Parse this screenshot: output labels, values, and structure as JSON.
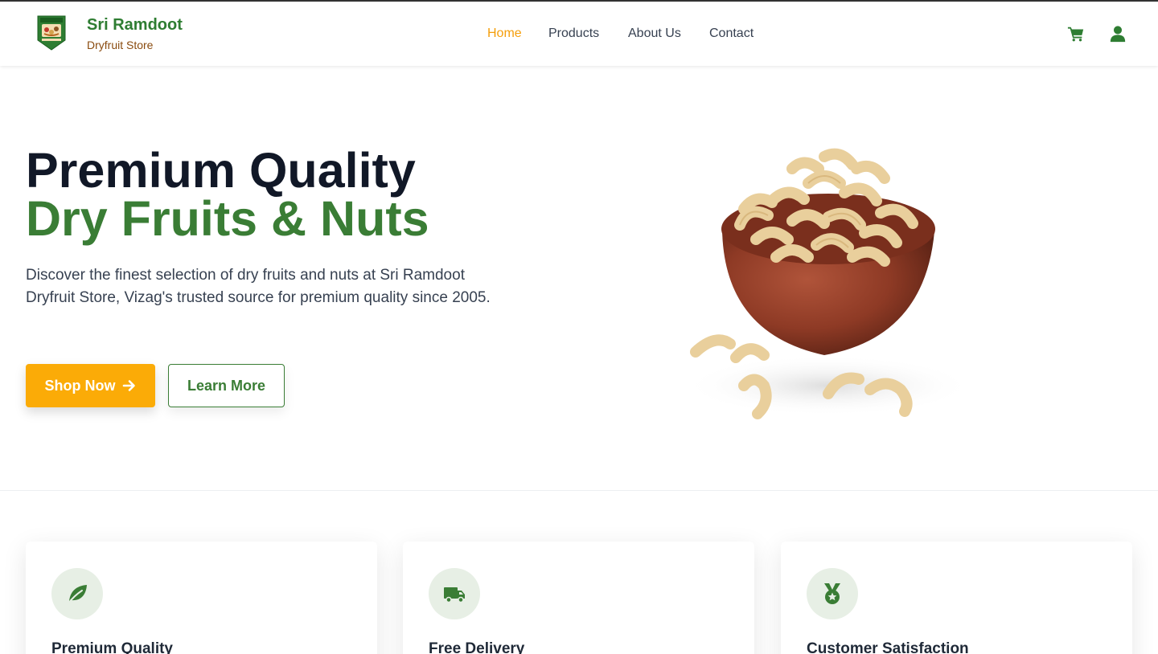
{
  "brand": {
    "name": "Sri Ramdoot",
    "subtitle": "Dryfruit Store",
    "logo_icon": "shield-badge-logo",
    "name_color": "#2e7d32"
  },
  "nav": [
    {
      "label": "Home",
      "active": true
    },
    {
      "label": "Products",
      "active": false
    },
    {
      "label": "About Us",
      "active": false
    },
    {
      "label": "Contact",
      "active": false
    }
  ],
  "header_icons": [
    "cart-icon",
    "user-icon"
  ],
  "hero": {
    "title_line1": "Premium Quality",
    "title_line2": "Dry Fruits & Nuts",
    "description": "Discover the finest selection of dry fruits and nuts at Sri Ramdoot Dryfruit Store, Vizag's trusted source for premium quality since 2005.",
    "primary_button": "Shop Now",
    "primary_button_icon": "arrow-right-icon",
    "secondary_button": "Learn More",
    "image": "bowl-of-cashews"
  },
  "features": [
    {
      "title": "Premium Quality",
      "icon": "leaf-icon"
    },
    {
      "title": "Free Delivery",
      "icon": "truck-icon"
    },
    {
      "title": "Customer Satisfaction",
      "icon": "medal-icon"
    }
  ],
  "colors": {
    "accent": "#fbab07",
    "brand_green": "#3a7d35",
    "dark": "#111827",
    "brown": "#8a4b0f",
    "icon_bg": "#e7efe5"
  }
}
